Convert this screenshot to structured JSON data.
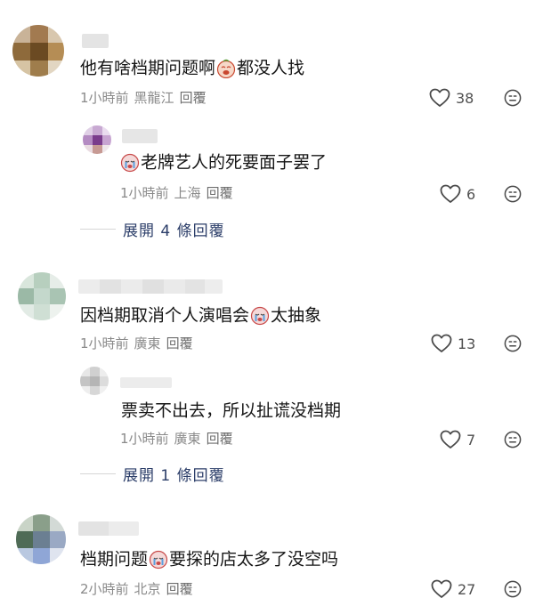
{
  "comments": [
    {
      "text_before": "他有啥档期问题啊",
      "emoji": "laugh-cry-emoji",
      "text_after": "都没人找",
      "time": "1小時前",
      "location": "黑龍江",
      "reply_label": "回覆",
      "likes": "38",
      "replies": [
        {
          "text_before": "",
          "emoji": "crying-emoji",
          "text_after": "老牌艺人的死要面子罢了",
          "time": "1小時前",
          "location": "上海",
          "reply_label": "回覆",
          "likes": "6"
        }
      ],
      "expand_label": "展開 4 條回覆"
    },
    {
      "text_before": "因档期取消个人演唱会",
      "emoji": "crying-emoji",
      "text_after": "太抽象",
      "time": "1小時前",
      "location": "廣東",
      "reply_label": "回覆",
      "likes": "13",
      "replies": [
        {
          "text_before": "票卖不出去，所以扯谎没档期",
          "emoji": "",
          "text_after": "",
          "time": "1小時前",
          "location": "廣東",
          "reply_label": "回覆",
          "likes": "7"
        }
      ],
      "expand_label": "展開 1 條回覆"
    },
    {
      "text_before": "档期问题",
      "emoji": "crying-emoji",
      "text_after": "要探的店太多了没空吗",
      "time": "2小時前",
      "location": "北京",
      "reply_label": "回覆",
      "likes": "27",
      "replies": []
    }
  ],
  "colors": {
    "meta": "#8a8a8a",
    "expand": "#2c3e69",
    "icon": "#4a4a4a"
  }
}
